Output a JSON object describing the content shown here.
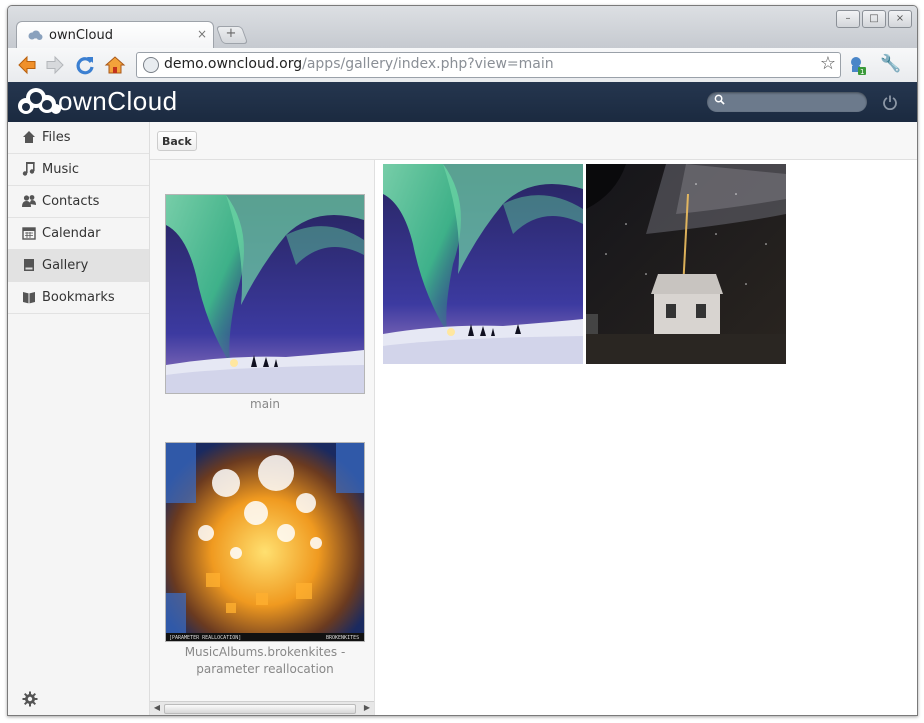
{
  "browser": {
    "tab_title": "ownCloud",
    "tab_close": "×",
    "new_tab": "+",
    "url_host": "demo.owncloud.org",
    "url_path": "/apps/gallery/index.php?view=main",
    "window_buttons": [
      "–",
      "□",
      "×"
    ]
  },
  "header": {
    "logo_text": "ownCloud",
    "search_placeholder": ""
  },
  "sidebar": {
    "items": [
      {
        "label": "Files",
        "icon": "home-icon"
      },
      {
        "label": "Music",
        "icon": "music-note-icon"
      },
      {
        "label": "Contacts",
        "icon": "people-icon"
      },
      {
        "label": "Calendar",
        "icon": "calendar-icon"
      },
      {
        "label": "Gallery",
        "icon": "picture-icon",
        "active": true
      },
      {
        "label": "Bookmarks",
        "icon": "book-icon"
      }
    ]
  },
  "controls": {
    "back_label": "Back"
  },
  "albums": [
    {
      "caption": "main"
    },
    {
      "caption_line1": "MusicAlbums.brokenkites -",
      "caption_line2": "parameter reallocation"
    }
  ],
  "colors": {
    "header_bg": "#1d2d44",
    "sidebar_bg": "#f5f5f5",
    "active_item": "#e2e2e2"
  }
}
